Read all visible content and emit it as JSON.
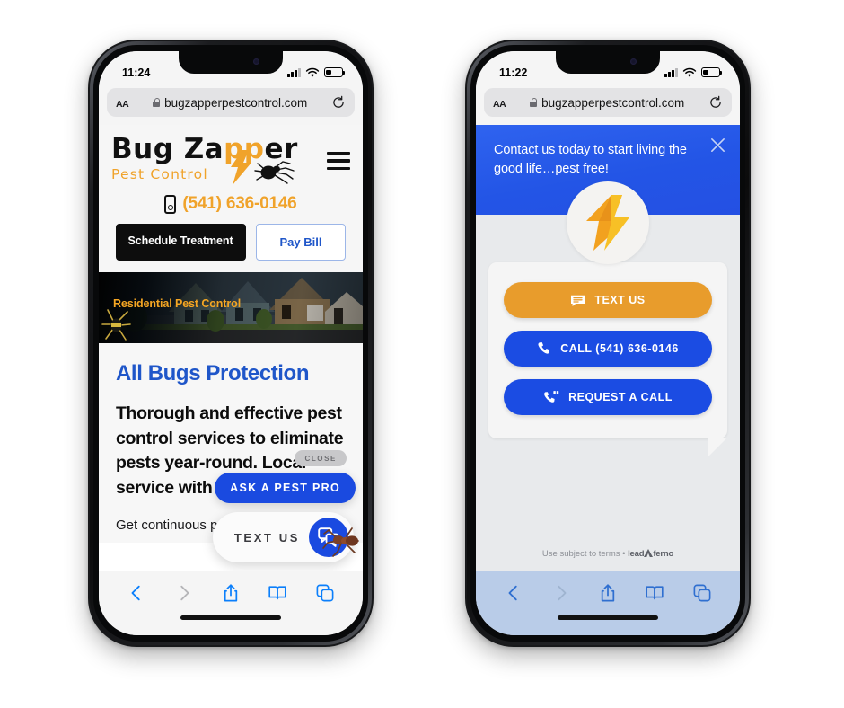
{
  "page": {
    "background": "#ffffff",
    "accent_blue": "#1a4ae0",
    "accent_orange": "#f0a32b"
  },
  "phones": [
    {
      "id": "left",
      "status": {
        "time": "11:24",
        "signal": "signal-bars",
        "wifi": "wifi-icon",
        "battery": "battery-low-icon"
      },
      "browser": {
        "text_size_label": "AA",
        "lock": "lock-icon",
        "url": "bugzapperpestcontrol.com",
        "reload": "reload-icon"
      },
      "site": {
        "logo": {
          "word1": "Bug",
          "word2_dark_a": "Za",
          "word2_orange": "pp",
          "word2_dark_b": "er",
          "tagline": "Pest Control"
        },
        "menu": "hamburger-menu",
        "phone_number": "(541) 636-0146",
        "buttons": {
          "primary": "Schedule Treatment",
          "secondary": "Pay Bill"
        },
        "hero_label": "Residential Pest Control",
        "heading": "All Bugs Protection",
        "lead": "Thorough and effective pest control services to eliminate pests year-round. Local service with a No Bugs Gu",
        "body": "Get continuous protection from all"
      },
      "widget": {
        "close_label": "CLOSE",
        "prompt_label": "ASK A PEST PRO",
        "pill_label": "TEXT US",
        "bubble_icon": "chat-bubbles-icon",
        "mascot": "ant-illustration"
      },
      "toolbar": {
        "tinted": false,
        "items": [
          "back-icon",
          "forward-icon",
          "share-icon",
          "bookmarks-icon",
          "tabs-icon"
        ]
      }
    },
    {
      "id": "right",
      "status": {
        "time": "11:22",
        "signal": "signal-bars",
        "wifi": "wifi-icon",
        "battery": "battery-low-icon"
      },
      "browser": {
        "text_size_label": "AA",
        "lock": "lock-icon",
        "url": "bugzapperpestcontrol.com",
        "reload": "reload-icon"
      },
      "messenger": {
        "greeting": "Contact us today to start living the good life…pest free!",
        "close_icon": "close-x-icon",
        "avatar_icon": "lightning-bolt-avatar",
        "actions": [
          {
            "label": "TEXT US",
            "icon": "message-icon",
            "color": "#e89c2c"
          },
          {
            "label": "CALL (541) 636-0146",
            "icon": "phone-icon",
            "color": "#1b4ce3"
          },
          {
            "label": "REQUEST A CALL",
            "icon": "phone-callback-icon",
            "color": "#1b4ce3"
          }
        ],
        "footer_terms": "Use subject to terms",
        "footer_sep": "•",
        "footer_brand_a": "lead",
        "footer_brand_b": "ferno"
      },
      "toolbar": {
        "tinted": true,
        "items": [
          "back-icon",
          "forward-icon",
          "share-icon",
          "bookmarks-icon",
          "tabs-icon"
        ]
      }
    }
  ]
}
